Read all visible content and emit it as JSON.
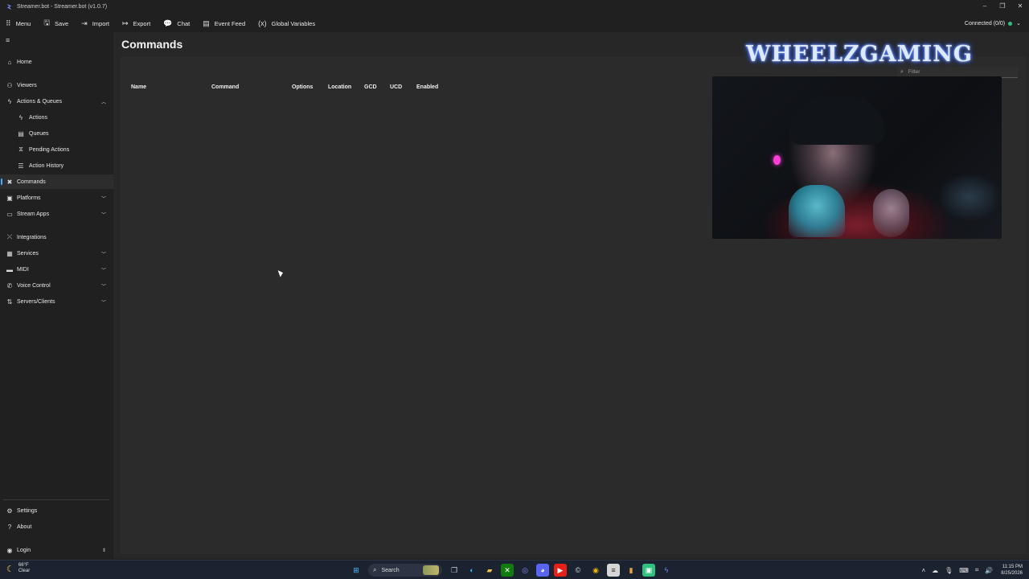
{
  "window": {
    "title": "Streamer.bot - Streamer.bot (v1.0.7)",
    "controls": [
      "–",
      "❐",
      "✕"
    ]
  },
  "toolbar": {
    "items": [
      {
        "label": "Menu",
        "icon": "grid-icon"
      },
      {
        "label": "Save",
        "icon": "save-icon"
      },
      {
        "label": "Import",
        "icon": "import-icon"
      },
      {
        "label": "Export",
        "icon": "export-icon"
      },
      {
        "label": "Chat",
        "icon": "chat-icon"
      },
      {
        "label": "Event Feed",
        "icon": "event-feed-icon"
      },
      {
        "label": "Global Variables",
        "icon": "variables-icon"
      }
    ],
    "connection": {
      "label": "Connected (0/0)",
      "status_color": "#2ec27e"
    }
  },
  "sidebar": {
    "items": [
      {
        "label": "Home",
        "icon": "home-icon"
      },
      {
        "label": "Viewers",
        "icon": "viewers-icon"
      },
      {
        "label": "Actions & Queues",
        "icon": "actions-icon",
        "expanded": true
      },
      {
        "label": "Actions",
        "icon": "lightning-icon"
      },
      {
        "label": "Queues",
        "icon": "queue-icon"
      },
      {
        "label": "Pending Actions",
        "icon": "pending-icon"
      },
      {
        "label": "Action History",
        "icon": "history-icon"
      },
      {
        "label": "Commands",
        "icon": "commands-icon",
        "selected": true
      },
      {
        "label": "Platforms",
        "icon": "platforms-icon"
      },
      {
        "label": "Stream Apps",
        "icon": "stream-apps-icon"
      },
      {
        "label": "Integrations",
        "icon": "integrations-icon"
      },
      {
        "label": "Services",
        "icon": "services-icon"
      },
      {
        "label": "MIDI",
        "icon": "midi-icon"
      },
      {
        "label": "Voice Control",
        "icon": "voice-icon"
      },
      {
        "label": "Servers/Clients",
        "icon": "servers-icon"
      }
    ],
    "footer": [
      {
        "label": "Settings",
        "icon": "gear-icon"
      },
      {
        "label": "About",
        "icon": "question-icon"
      },
      {
        "label": "Login",
        "icon": "user-icon"
      }
    ]
  },
  "main": {
    "title": "Commands",
    "columns": [
      "Name",
      "Command",
      "Options",
      "Location",
      "GCD",
      "UCD",
      "Enabled"
    ],
    "filter_placeholder": "Filter"
  },
  "overlay": {
    "channel_name": "WHEELZGAMING"
  },
  "taskbar": {
    "weather": {
      "temp": "66°F",
      "condition": "Clear"
    },
    "search_label": "Search",
    "time": "11:15 PM",
    "date": "8/25/2026"
  }
}
